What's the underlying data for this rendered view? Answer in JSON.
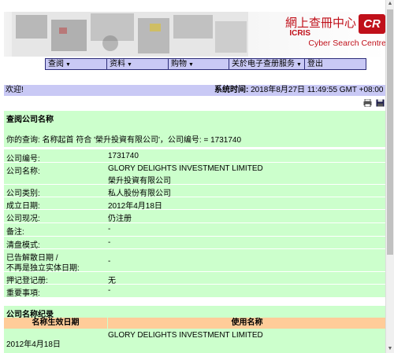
{
  "banner": {
    "brand_zh": "網上查冊中心",
    "brand_en1": "ICRIS",
    "brand_en2": "Cyber Search Centre",
    "logo_text": "CR"
  },
  "menu": [
    {
      "label": "查阅",
      "has_arrow": true
    },
    {
      "label": "资料",
      "has_arrow": true
    },
    {
      "label": "购物",
      "has_arrow": true
    },
    {
      "label": "关於电子查册服务",
      "has_arrow": true
    },
    {
      "label": "登出",
      "has_arrow": false
    }
  ],
  "status": {
    "welcome": "欢迎!",
    "time_label": "系统时间:",
    "time_value": "2018年8月27日 11:49:55 GMT +08:00"
  },
  "query": {
    "title": "查阅公司名称",
    "text": "你的查询:   名称起首 符合 '榮升投資有限公司'，公司编号:   = 1731740"
  },
  "details": [
    {
      "label": "公司编号:",
      "value": "1731740"
    },
    {
      "label": "公司名称:",
      "value": "GLORY DELIGHTS INVESTMENT LIMITED",
      "value2": "榮升投資有限公司"
    },
    {
      "label": "公司类别:",
      "value": "私人股份有限公司"
    },
    {
      "label": "成立日期:",
      "value": "2012年4月18日"
    },
    {
      "label": "公司现况:",
      "value": "仍注册"
    },
    {
      "label": "备注:",
      "value": "-"
    },
    {
      "label": "清盘模式:",
      "value": "-"
    },
    {
      "label": "已告解散日期 /",
      "label2": "不再是独立实体日期:",
      "value": "-"
    },
    {
      "label": "押记登记册:",
      "value": "无"
    },
    {
      "label": "重要事項:",
      "value": "-"
    }
  ],
  "history": {
    "title": "公司名称纪录",
    "col1": "名称生效日期",
    "col2": "使用名称",
    "rows": [
      {
        "date": "2012年4月18日",
        "name": "GLORY DELIGHTS INVESTMENT LIMITED"
      }
    ]
  },
  "colors": {
    "nav": "#c9c9f5",
    "panel": "#ccffcc",
    "header": "#ffcc99",
    "brand": "#c0101a"
  }
}
